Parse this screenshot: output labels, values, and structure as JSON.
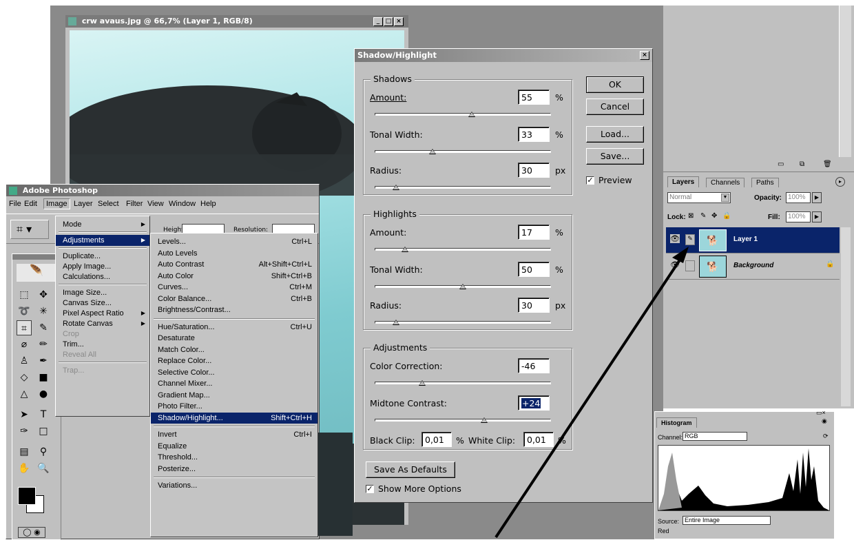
{
  "doc_window": {
    "title": "crw avaus.jpg @ 66,7% (Layer 1, RGB/8)",
    "controls": [
      "_",
      "□",
      "×"
    ]
  },
  "dialog": {
    "title": "Shadow/Highlight",
    "close": "×",
    "shadows": {
      "title": "Shadows",
      "amount_label": "Amount:",
      "amount": "55",
      "amount_unit": "%",
      "amount_pos": 0.55,
      "tonal_label": "Tonal Width:",
      "tonal": "33",
      "tonal_unit": "%",
      "tonal_pos": 0.33,
      "radius_label": "Radius:",
      "radius": "30",
      "radius_unit": "px",
      "radius_pos": 0.12
    },
    "highlights": {
      "title": "Highlights",
      "amount_label": "Amount:",
      "amount": "17",
      "amount_unit": "%",
      "amount_pos": 0.17,
      "tonal_label": "Tonal Width:",
      "tonal": "50",
      "tonal_unit": "%",
      "tonal_pos": 0.5,
      "radius_label": "Radius:",
      "radius": "30",
      "radius_unit": "px",
      "radius_pos": 0.12
    },
    "adjustments": {
      "title": "Adjustments",
      "color_label": "Color Correction:",
      "color": "-46",
      "color_pos": 0.27,
      "midtone_label": "Midtone Contrast:",
      "midtone": "+24",
      "midtone_pos": 0.62,
      "black_label": "Black Clip:",
      "black": "0,01",
      "black_unit": "%",
      "white_label": "White Clip:",
      "white": "0,01",
      "white_unit": "%"
    },
    "buttons": {
      "ok": "OK",
      "cancel": "Cancel",
      "load": "Load...",
      "save": "Save...",
      "save_defaults": "Save As Defaults"
    },
    "preview_label": "Preview",
    "preview_checked": "✓",
    "more_options_label": "Show More Options",
    "more_options_checked": "✓"
  },
  "photoshop": {
    "title": "Adobe Photoshop",
    "menubar": [
      "File",
      "Edit",
      "Image",
      "Layer",
      "Select",
      "Filter",
      "View",
      "Window",
      "Help"
    ],
    "options": {
      "height_label": "Height:",
      "resolution_label": "Resolution:"
    }
  },
  "image_menu": {
    "items": [
      {
        "label": "Mode",
        "arrow": true
      },
      {
        "label": "Adjustments",
        "arrow": true,
        "selected": true
      },
      {
        "label": "Duplicate..."
      },
      {
        "label": "Apply Image..."
      },
      {
        "label": "Calculations..."
      },
      {
        "label": "Image Size..."
      },
      {
        "label": "Canvas Size..."
      },
      {
        "label": "Pixel Aspect Ratio",
        "arrow": true
      },
      {
        "label": "Rotate Canvas",
        "arrow": true
      },
      {
        "label": "Crop",
        "disabled": true
      },
      {
        "label": "Trim..."
      },
      {
        "label": "Reveal All",
        "disabled": true
      },
      {
        "label": "Trap...",
        "disabled": true
      }
    ]
  },
  "adjust_menu": {
    "items": [
      {
        "label": "Levels...",
        "shortcut": "Ctrl+L"
      },
      {
        "label": "Auto Levels",
        "shortcut": ""
      },
      {
        "label": "Auto Contrast",
        "shortcut": "Alt+Shift+Ctrl+L"
      },
      {
        "label": "Auto Color",
        "shortcut": "Shift+Ctrl+B"
      },
      {
        "label": "Curves...",
        "shortcut": "Ctrl+M"
      },
      {
        "label": "Color Balance...",
        "shortcut": "Ctrl+B"
      },
      {
        "label": "Brightness/Contrast...",
        "shortcut": ""
      },
      {
        "label": "Hue/Saturation...",
        "shortcut": "Ctrl+U"
      },
      {
        "label": "Desaturate",
        "shortcut": ""
      },
      {
        "label": "Match Color...",
        "shortcut": ""
      },
      {
        "label": "Replace Color...",
        "shortcut": ""
      },
      {
        "label": "Selective Color...",
        "shortcut": ""
      },
      {
        "label": "Channel Mixer...",
        "shortcut": ""
      },
      {
        "label": "Gradient Map...",
        "shortcut": ""
      },
      {
        "label": "Photo Filter...",
        "shortcut": ""
      },
      {
        "label": "Shadow/Highlight...",
        "shortcut": "Shift+Ctrl+H",
        "selected": true
      },
      {
        "label": "Invert",
        "shortcut": "Ctrl+I"
      },
      {
        "label": "Equalize",
        "shortcut": ""
      },
      {
        "label": "Threshold...",
        "shortcut": ""
      },
      {
        "label": "Posterize...",
        "shortcut": ""
      },
      {
        "label": "Variations...",
        "shortcut": ""
      }
    ]
  },
  "layers_panel": {
    "tabs": [
      "Layers",
      "Channels",
      "Paths"
    ],
    "blend_mode": "Normal",
    "opacity_label": "Opacity:",
    "opacity": "100%",
    "lock_label": "Lock:",
    "fill_label": "Fill:",
    "fill": "100%",
    "layers": [
      {
        "name": "Layer 1",
        "selected": true
      },
      {
        "name": "Background",
        "selected": false
      }
    ]
  },
  "histogram": {
    "tab": "Histogram",
    "channel_label": "Channel:",
    "channel": "RGB",
    "source_label": "Source:",
    "source": "Entire Image",
    "red_label": "Red"
  },
  "colors": {
    "accent": "#0a246a",
    "photo": "#8fd3d8",
    "canvas": "#8a8a8a"
  }
}
